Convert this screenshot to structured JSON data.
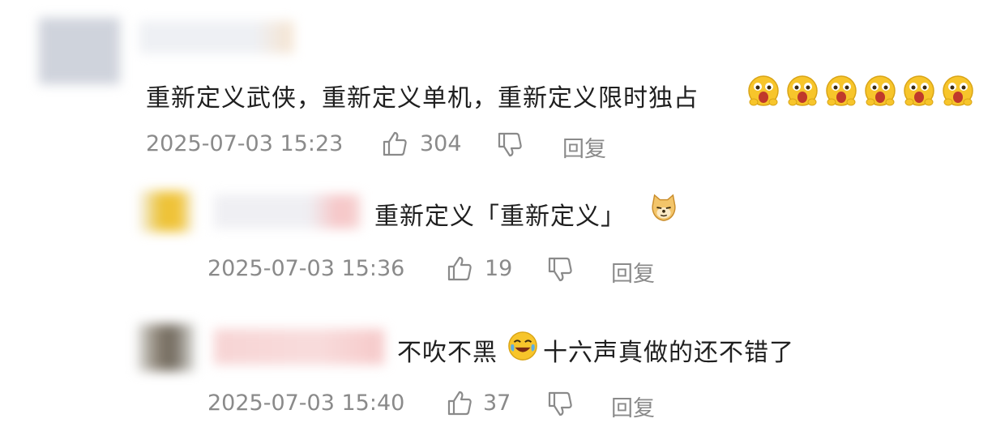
{
  "comments": [
    {
      "text": "重新定义武侠，重新定义单机，重新定义限时独占",
      "emoji": "wow-face-emoji",
      "emoji_count": 6,
      "timestamp": "2025-07-03 15:23",
      "likes": "304",
      "reply_label": "回复",
      "replies": [
        {
          "text": "重新定义「重新定义」",
          "emoji": "doge-emoji",
          "timestamp": "2025-07-03 15:36",
          "likes": "19",
          "reply_label": "回复"
        },
        {
          "text_a": "不吹不黑",
          "emoji": "laughing-cry-emoji",
          "text_b": "十六声真做的还不错了",
          "timestamp": "2025-07-03 15:40",
          "likes": "37",
          "reply_label": "回复"
        }
      ]
    }
  ],
  "colors": {
    "meta_text": "#8a8a8a",
    "body_text": "#1f1f1f",
    "emoji_yellow": "#f7c52b"
  }
}
